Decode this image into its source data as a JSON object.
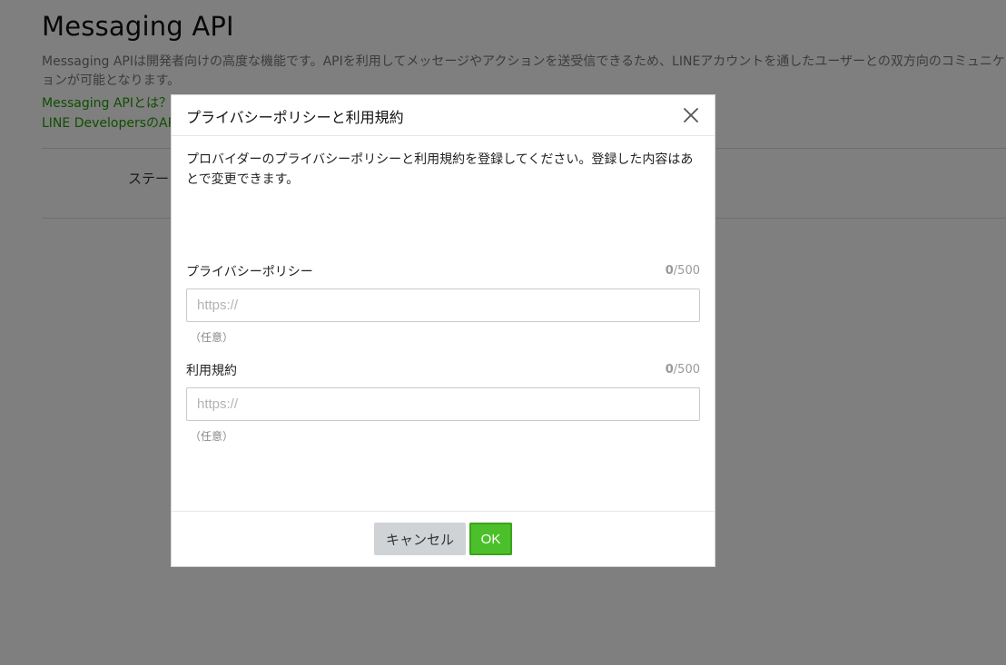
{
  "page": {
    "title": "Messaging API",
    "description_line1": "Messaging APIは開発者向けの高度な機能です。APIを利用してメッセージやアクションを送受信できるため、LINEアカウントを通したユーザーとの双方向のコミュニケーション",
    "description_line2": "ョンが可能となります。",
    "link_1": "Messaging APIとは？",
    "link_2": "LINE DevelopersのAP",
    "status_label": "ステー"
  },
  "modal": {
    "title": "プライバシーポリシーと利用規約",
    "intro": "プロバイダーのプライバシーポリシーと利用規約を登録してください。登録した内容はあとで変更できます。",
    "privacy": {
      "label": "プライバシーポリシー",
      "count": "0",
      "max": "/500",
      "value": "",
      "placeholder": "https://",
      "hint": "（任意）"
    },
    "terms": {
      "label": "利用規約",
      "count": "0",
      "max": "/500",
      "value": "",
      "placeholder": "https://",
      "hint": "（任意）"
    },
    "cancel_label": "キャンセル",
    "ok_label": "OK"
  },
  "icons": {
    "close": "close-icon"
  },
  "colors": {
    "link_green": "#1e9c00",
    "ok_green": "#4cc02a",
    "cancel_gray": "#d0d3d6",
    "overlay": "rgba(0,0,0,0.5)"
  }
}
